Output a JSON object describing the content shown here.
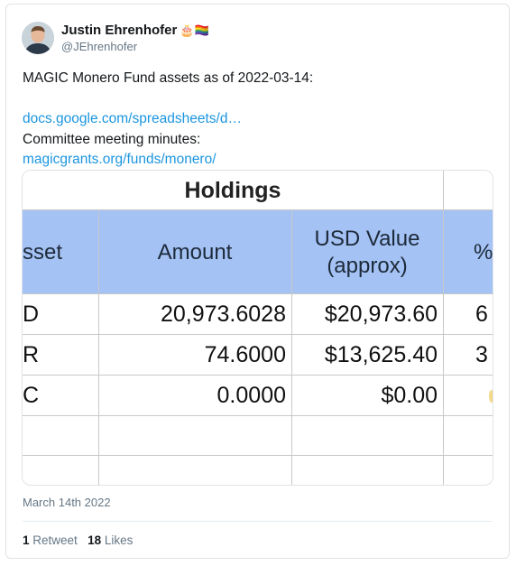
{
  "tweet": {
    "author_name": "Justin Ehrenhofer",
    "author_emoji": "🎂🏳️‍🌈",
    "handle": "@JEhrenhofer",
    "line1": "MAGIC Monero Fund assets as of 2022-03-14:",
    "link1": "docs.google.com/spreadsheets/d…",
    "line2": "Committee meeting minutes:",
    "link2": "magicgrants.org/funds/monero/",
    "date": "March 14th 2022",
    "retweets_count": "1",
    "retweets_label": "Retweet",
    "likes_count": "18",
    "likes_label": "Likes"
  },
  "sheet": {
    "title": "Holdings",
    "headers": {
      "asset": "sset",
      "amount": "Amount",
      "usd_line1": "USD Value",
      "usd_line2": "(approx)",
      "pct": "%"
    },
    "rows": [
      {
        "asset": "D",
        "amount": "20,973.6028",
        "usd": "$20,973.60",
        "pct": "6"
      },
      {
        "asset": "R",
        "amount": "74.6000",
        "usd": "$13,625.40",
        "pct": "3"
      },
      {
        "asset": "C",
        "amount": "0.0000",
        "usd": "$0.00",
        "pct": ""
      }
    ]
  }
}
